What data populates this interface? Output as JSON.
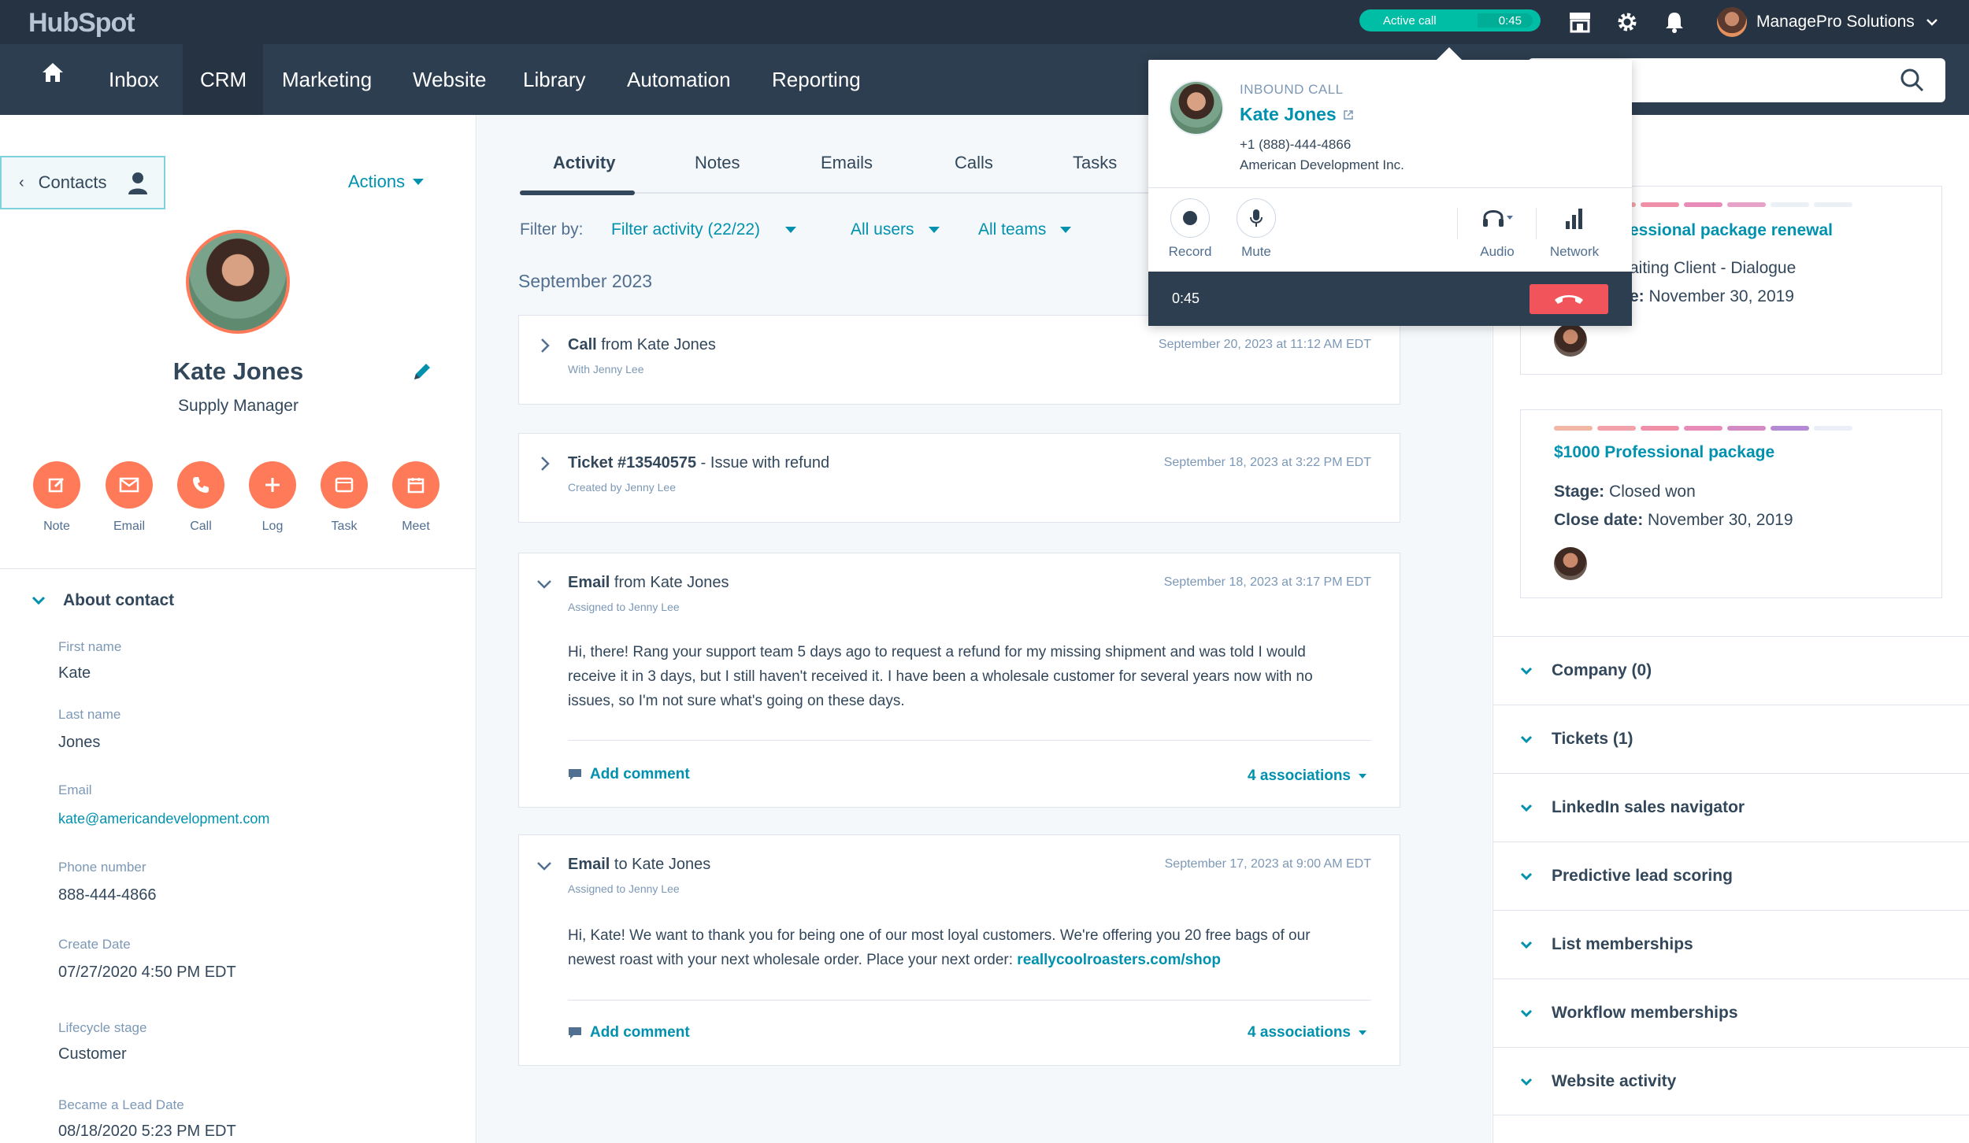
{
  "topbar": {
    "logo": "HubSpot",
    "active_call_label": "Active call",
    "active_call_time": "0:45",
    "account_name": "ManagePro Solutions"
  },
  "nav": {
    "items": [
      "Inbox",
      "CRM",
      "Marketing",
      "Website",
      "Library",
      "Automation",
      "Reporting"
    ],
    "active": "CRM"
  },
  "left": {
    "back_label": "Contacts",
    "actions_label": "Actions",
    "name": "Kate Jones",
    "title": "Supply Manager",
    "quick_actions": [
      "Note",
      "Email",
      "Call",
      "Log",
      "Task",
      "Meet"
    ],
    "about_label": "About contact",
    "fields": [
      {
        "label": "First name",
        "value": "Kate"
      },
      {
        "label": "Last name",
        "value": "Jones"
      },
      {
        "label": "Email",
        "value": "kate@americandevelopment.com"
      },
      {
        "label": "Phone number",
        "value": "888-444-4866"
      },
      {
        "label": "Create Date",
        "value": "07/27/2020 4:50 PM EDT"
      },
      {
        "label": "Lifecycle stage",
        "value": "Customer"
      },
      {
        "label": "Became a Lead Date",
        "value": "08/18/2020 5:23 PM EDT"
      }
    ]
  },
  "center": {
    "tabs": [
      "Activity",
      "Notes",
      "Emails",
      "Calls",
      "Tasks"
    ],
    "filter_by_label": "Filter by:",
    "filter_activity": "Filter activity (22/22)",
    "filter_users": "All users",
    "filter_teams": "All teams",
    "month": "September 2023",
    "cards": [
      {
        "bold": "Call",
        "rest": " from Kate Jones",
        "sub": "With Jenny Lee",
        "date": "September 20, 2023 at 11:12 AM EDT"
      },
      {
        "bold": "Ticket #13540575",
        "rest": " - Issue with refund",
        "sub": "Created by Jenny Lee",
        "date": "September 18, 2023 at 3:22 PM EDT"
      },
      {
        "bold": "Email",
        "rest": " from Kate Jones",
        "sub": "Assigned to Jenny Lee",
        "date": "September 18, 2023 at 3:17 PM EDT",
        "body": "Hi, there! Rang your support team 5 days ago to request a refund for my missing shipment and was told I would receive it in 3 days, but I still haven't received it. I have been a wholesale customer for several years now with no issues, so I'm not sure what's going on these days.",
        "comment": "Add comment",
        "associations": "4 associations"
      },
      {
        "bold": "Email",
        "rest": " to Kate Jones",
        "sub": "Assigned to Jenny Lee",
        "date": "September 17, 2023 at 9:00 AM EDT",
        "body": "Hi, Kate! We want to thank you for being one of our most loyal customers. We're offering you 20 free bags of our newest roast with your next wholesale order. Place your next order: ",
        "link": "reallycoolroasters.com/shop",
        "comment": "Add comment",
        "associations": "4 associations"
      }
    ]
  },
  "right": {
    "deals": [
      {
        "title": "essional package renewal",
        "line1": "aiting Client - Dialogue",
        "line2_label": "e:",
        "line2_value": "November 30, 2019"
      },
      {
        "title": "$1000 Professional package",
        "stage_label": "Stage:",
        "stage_value": "Closed won",
        "close_label": "Close date:",
        "close_value": "November 30, 2019"
      }
    ],
    "sections": [
      "Company (0)",
      "Tickets (1)",
      "LinkedIn sales navigator",
      "Predictive lead scoring",
      "List memberships",
      "Workflow memberships",
      "Website activity"
    ]
  },
  "call_popup": {
    "label": "INBOUND CALL",
    "name": "Kate Jones",
    "phone": "+1 (888)-444-4866",
    "company": "American Development Inc.",
    "controls": [
      "Record",
      "Mute",
      "Audio",
      "Network"
    ],
    "timer": "0:45"
  },
  "colors": {
    "accent": "#0091ae",
    "orange": "#ff7a59",
    "nav": "#2d3e50",
    "topbar": "#253342",
    "teal": "#00bda5",
    "hangup": "#f2545b"
  }
}
